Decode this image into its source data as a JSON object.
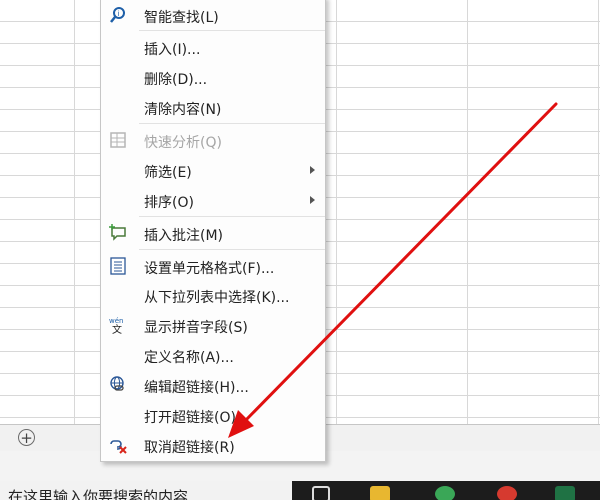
{
  "menu": {
    "items": [
      {
        "label": "智能查找(L)",
        "icon": "smart-lookup-icon",
        "disabled": false
      },
      {
        "label": "插入(I)...",
        "icon": "",
        "disabled": false
      },
      {
        "label": "删除(D)...",
        "icon": "",
        "disabled": false
      },
      {
        "label": "清除内容(N)",
        "icon": "",
        "disabled": false
      },
      {
        "label": "快速分析(Q)",
        "icon": "quick-analysis-icon",
        "disabled": true
      },
      {
        "label": "筛选(E)",
        "icon": "",
        "disabled": false,
        "submenu": true
      },
      {
        "label": "排序(O)",
        "icon": "",
        "disabled": false,
        "submenu": true
      },
      {
        "label": "插入批注(M)",
        "icon": "insert-comment-icon",
        "disabled": false
      },
      {
        "label": "设置单元格格式(F)...",
        "icon": "format-cells-icon",
        "disabled": false
      },
      {
        "label": "从下拉列表中选择(K)...",
        "icon": "",
        "disabled": false
      },
      {
        "label": "显示拼音字段(S)",
        "icon": "phonetic-icon",
        "disabled": false
      },
      {
        "label": "定义名称(A)...",
        "icon": "",
        "disabled": false
      },
      {
        "label": "编辑超链接(H)...",
        "icon": "edit-hyperlink-icon",
        "disabled": false
      },
      {
        "label": "打开超链接(O)",
        "icon": "",
        "disabled": false
      },
      {
        "label": "取消超链接(R)",
        "icon": "remove-hyperlink-icon",
        "disabled": false
      }
    ]
  },
  "sheet_tabs": {
    "add_label": "+"
  },
  "taskbar": {
    "search_text": "在这里输入你要搜索的内容"
  },
  "colors": {
    "annotation_arrow": "#e01010",
    "menu_background": "#fdfdfd"
  }
}
